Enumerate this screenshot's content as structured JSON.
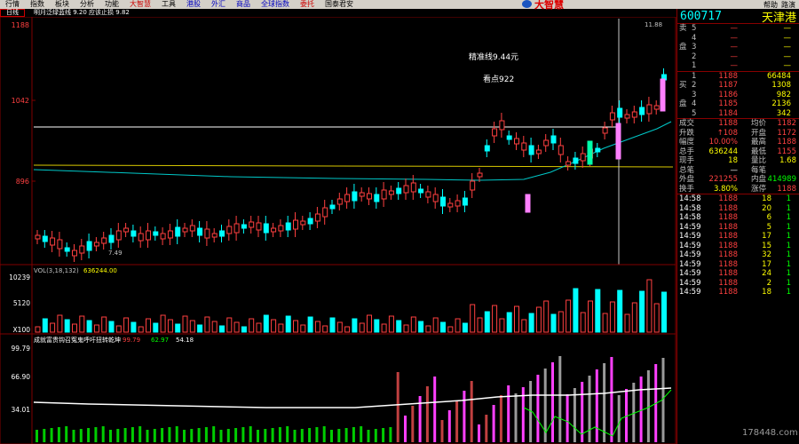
{
  "menu": {
    "items": [
      "行情",
      "指数",
      "板块",
      "分析",
      "功能",
      "大智慧",
      "工具",
      "港股",
      "外汇",
      "商品",
      "全球指数",
      "委托",
      "国泰君安"
    ],
    "right": [
      "帮助",
      "路演"
    ]
  },
  "brand": {
    "name": "大智慧"
  },
  "tabs": {
    "period": "日线"
  },
  "indicator_title": "明月泛绿蓝线 9.20 应该止损 9.82",
  "price_axis": {
    "top": "1188",
    "mid": "1042",
    "low": "896"
  },
  "annotations": {
    "line_label": "精准线9.44元",
    "watch_label": "看点922",
    "peak_label": "11.88",
    "low_label": "7.49"
  },
  "vol": {
    "title": "VOL(3,18,132)",
    "value": "636244.00",
    "axis": [
      "10239",
      "5120",
      "X100"
    ]
  },
  "osc": {
    "title": "成就富贵钩召冤鬼呼吁扭转乾坤",
    "v1": "99.79",
    "v2": "62.97",
    "v3": "54.18",
    "axis": [
      "99.79",
      "66.90",
      "34.01"
    ]
  },
  "quote": {
    "code": "600717",
    "name": "天津港",
    "sell": [
      {
        "l": "卖",
        "n": "5",
        "p": "—",
        "v": "—"
      },
      {
        "l": "",
        "n": "4",
        "p": "—",
        "v": "—"
      },
      {
        "l": "盘",
        "n": "3",
        "p": "—",
        "v": "—"
      },
      {
        "l": "",
        "n": "2",
        "p": "—",
        "v": "—"
      },
      {
        "l": "",
        "n": "1",
        "p": "—",
        "v": "—"
      }
    ],
    "buy": [
      {
        "l": "",
        "n": "1",
        "p": "1188",
        "v": "66484"
      },
      {
        "l": "买",
        "n": "2",
        "p": "1187",
        "v": "1308"
      },
      {
        "l": "",
        "n": "3",
        "p": "1186",
        "v": "982"
      },
      {
        "l": "盘",
        "n": "4",
        "p": "1185",
        "v": "2136"
      },
      {
        "l": "",
        "n": "5",
        "p": "1184",
        "v": "342"
      }
    ],
    "stats": [
      {
        "l1": "成交",
        "v1": "1188",
        "l2": "均价",
        "v2": "1182",
        "c1": "red",
        "c2": "red"
      },
      {
        "l1": "升跌",
        "v1": "↑108",
        "l2": "开盘",
        "v2": "1172",
        "c1": "red",
        "c2": "red"
      },
      {
        "l1": "幅度",
        "v1": "10.00%",
        "l2": "最高",
        "v2": "1188",
        "c1": "red",
        "c2": "red"
      },
      {
        "l1": "总手",
        "v1": "636244",
        "l2": "最低",
        "v2": "1155",
        "c1": "yellow",
        "c2": "red"
      },
      {
        "l1": "现手",
        "v1": "18",
        "l2": "量比",
        "v2": "1.68",
        "c1": "yellow",
        "c2": "yellow"
      },
      {
        "l1": "总笔",
        "v1": "—",
        "l2": "每笔",
        "v2": "",
        "c1": "white",
        "c2": "white"
      },
      {
        "l1": "外盘",
        "v1": "221255",
        "l2": "内盘",
        "v2": "414989",
        "c1": "red",
        "c2": "green"
      },
      {
        "l1": "换手",
        "v1": "3.80%",
        "l2": "涨停",
        "v2": "1188",
        "c1": "yellow",
        "c2": "red"
      }
    ],
    "ticks": [
      {
        "t": "14:58",
        "p": "1188",
        "v": "18",
        "d": "1"
      },
      {
        "t": "14:58",
        "p": "1188",
        "v": "20",
        "d": "1"
      },
      {
        "t": "14:58",
        "p": "1188",
        "v": "6",
        "d": "1"
      },
      {
        "t": "14:59",
        "p": "1188",
        "v": "5",
        "d": "1"
      },
      {
        "t": "14:59",
        "p": "1188",
        "v": "17",
        "d": "1"
      },
      {
        "t": "14:59",
        "p": "1188",
        "v": "15",
        "d": "1"
      },
      {
        "t": "14:59",
        "p": "1188",
        "v": "32",
        "d": "1"
      },
      {
        "t": "14:59",
        "p": "1188",
        "v": "17",
        "d": "1"
      },
      {
        "t": "14:59",
        "p": "1188",
        "v": "24",
        "d": "1"
      },
      {
        "t": "14:59",
        "p": "1188",
        "v": "2",
        "d": "1"
      },
      {
        "t": "14:59",
        "p": "1188",
        "v": "18",
        "d": "1"
      }
    ]
  },
  "watermark": "178448.com",
  "colors": {
    "up": "#ff4040",
    "down": "#00ffff",
    "ma_yellow": "#ffff00",
    "ma_cyan": "#00c8c8",
    "grid": "#800000"
  }
}
